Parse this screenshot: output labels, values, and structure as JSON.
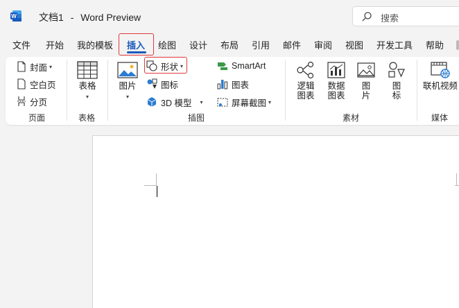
{
  "titlebar": {
    "doc_name": "文档1",
    "separator": "-",
    "app_name": "Word Preview",
    "search_placeholder": "搜索"
  },
  "tabs": [
    {
      "label": "文件",
      "selected": false
    },
    {
      "label": "开始",
      "selected": false
    },
    {
      "label": "我的模板",
      "selected": false
    },
    {
      "label": "插入",
      "selected": true
    },
    {
      "label": "绘图",
      "selected": false
    },
    {
      "label": "设计",
      "selected": false
    },
    {
      "label": "布局",
      "selected": false
    },
    {
      "label": "引用",
      "selected": false
    },
    {
      "label": "邮件",
      "selected": false
    },
    {
      "label": "审阅",
      "selected": false
    },
    {
      "label": "视图",
      "selected": false
    },
    {
      "label": "开发工具",
      "selected": false
    },
    {
      "label": "帮助",
      "selected": false
    }
  ],
  "ribbon": {
    "pages": {
      "cover": "封面",
      "blank": "空白页",
      "break": "分页",
      "label": "页面"
    },
    "tables": {
      "table": "表格",
      "label": "表格"
    },
    "illustrations": {
      "pictures": "图片",
      "shapes": "形状",
      "icons": "图标",
      "models3d": "3D 模型",
      "smartart": "SmartArt",
      "chart": "图表",
      "screenshot": "屏幕截图",
      "label": "插图"
    },
    "materials": {
      "logic_line1": "逻辑",
      "logic_line2": "图表",
      "data_line1": "数据",
      "data_line2": "图表",
      "picture_line1": "图",
      "picture_line2": "片",
      "icon_line1": "图",
      "icon_line2": "标",
      "label": "素材"
    },
    "media": {
      "online_video": "联机视频",
      "label": "媒体"
    }
  },
  "colors": {
    "accent": "#185abd",
    "highlight": "#e0383a",
    "word_blue": "#185abd"
  }
}
